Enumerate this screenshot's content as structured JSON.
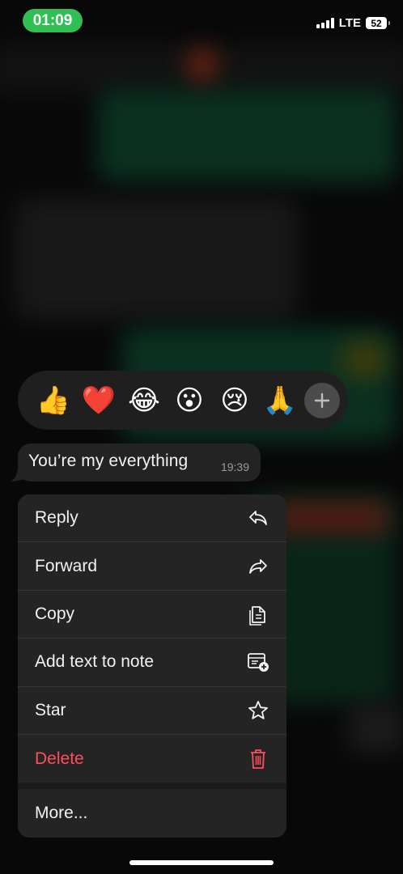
{
  "status_bar": {
    "time": "01:09",
    "network": "LTE",
    "battery": "52"
  },
  "reactions": [
    {
      "emoji": "👍",
      "name": "thumbs-up"
    },
    {
      "emoji": "❤️",
      "name": "heart"
    },
    {
      "emoji": "😂",
      "name": "tears-of-joy"
    },
    {
      "emoji": "😮",
      "name": "surprised"
    },
    {
      "emoji": "😢",
      "name": "crying"
    },
    {
      "emoji": "🙏",
      "name": "folded-hands"
    }
  ],
  "message": {
    "text": "You’re my everything",
    "time": "19:39"
  },
  "menu": {
    "reply": "Reply",
    "forward": "Forward",
    "copy": "Copy",
    "add_to_note": "Add text to note",
    "star": "Star",
    "delete": "Delete",
    "more": "More..."
  },
  "colors": {
    "status_pill": "#2fbf52",
    "delete": "#ff4d5e",
    "menu_bg": "#242424"
  }
}
